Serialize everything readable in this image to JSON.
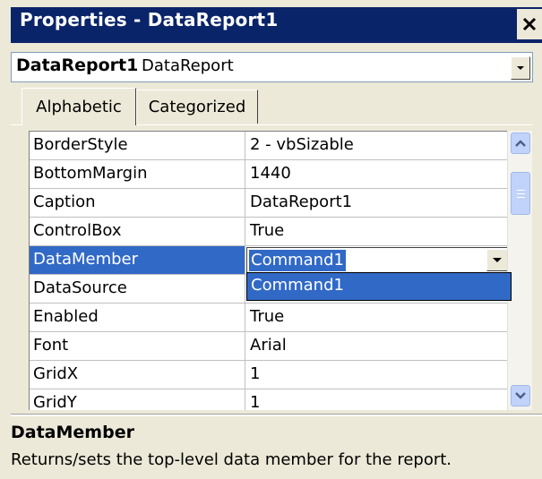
{
  "window": {
    "title": "Properties - DataReport1"
  },
  "object_selector": {
    "name": "DataReport1",
    "type": "DataReport"
  },
  "tabs": [
    {
      "label": "Alphabetic",
      "active": true
    },
    {
      "label": "Categorized",
      "active": false
    }
  ],
  "properties": [
    {
      "name": "BorderStyle",
      "value": "2 - vbSizable"
    },
    {
      "name": "BottomMargin",
      "value": "1440"
    },
    {
      "name": "Caption",
      "value": "DataReport1"
    },
    {
      "name": "ControlBox",
      "value": "True"
    },
    {
      "name": "DataMember",
      "value": "Command1",
      "selected": true
    },
    {
      "name": "DataSource",
      "value": ""
    },
    {
      "name": "Enabled",
      "value": "True"
    },
    {
      "name": "Font",
      "value": "Arial"
    },
    {
      "name": "GridX",
      "value": "1"
    },
    {
      "name": "GridY",
      "value": "1"
    }
  ],
  "dropdown": {
    "options": [
      "Command1"
    ]
  },
  "description": {
    "title": "DataMember",
    "text": "Returns/sets the top-level data member for the report."
  },
  "icons": {
    "close": "close-icon",
    "dropdown": "chevron-down-icon",
    "scroll_up": "scroll-up-icon",
    "scroll_down": "scroll-down-icon"
  },
  "colors": {
    "title_bar": "#0A246A",
    "selection": "#3169C6",
    "background": "#ECE9D8"
  }
}
